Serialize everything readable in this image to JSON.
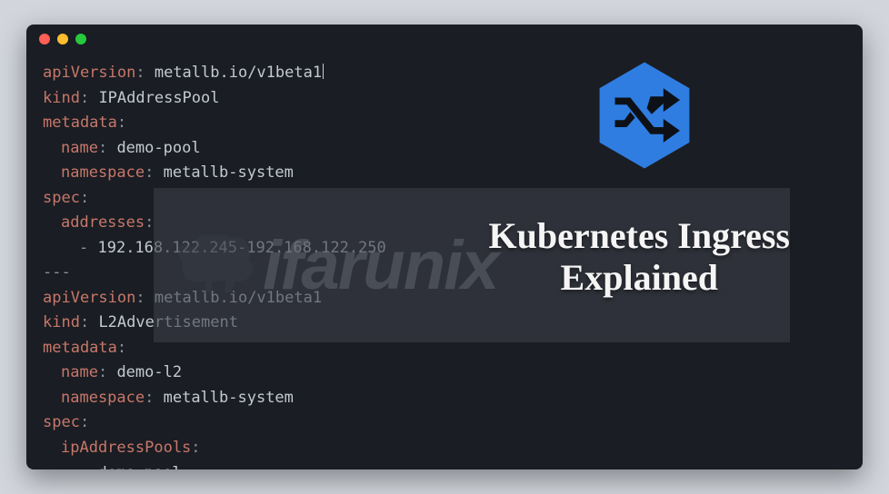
{
  "titlebar": {
    "dots": [
      "red",
      "yellow",
      "green"
    ]
  },
  "code": {
    "doc1": {
      "apiVersion_key": "apiVersion",
      "apiVersion_val": "metallb.io/v1beta1",
      "kind_key": "kind",
      "kind_val": "IPAddressPool",
      "metadata_key": "metadata",
      "name_key": "name",
      "name_val": "demo-pool",
      "namespace_key": "namespace",
      "namespace_val": "metallb-system",
      "spec_key": "spec",
      "addresses_key": "addresses",
      "addresses_item": "192.168.122.245-192.168.122.250"
    },
    "separator": "---",
    "doc2": {
      "apiVersion_key": "apiVersion",
      "apiVersion_val": "metallb.io/v1beta1",
      "kind_key": "kind",
      "kind_val": "L2Advertisement",
      "metadata_key": "metadata",
      "name_key": "name",
      "name_val": "demo-l2",
      "namespace_key": "namespace",
      "namespace_val": "metallb-system",
      "spec_key": "spec",
      "ipAddressPools_key": "ipAddressPools",
      "ipAddressPools_item": "demo-pool"
    }
  },
  "watermark": {
    "text": "ifarunix"
  },
  "overlay": {
    "line1": "Kubernetes Ingress",
    "line2": "Explained"
  },
  "colors": {
    "bg": "#d2d6dc",
    "terminal": "#1a1d23",
    "key": "#c7776a",
    "val": "#c4c9d2",
    "icon": "#2f7de1"
  }
}
